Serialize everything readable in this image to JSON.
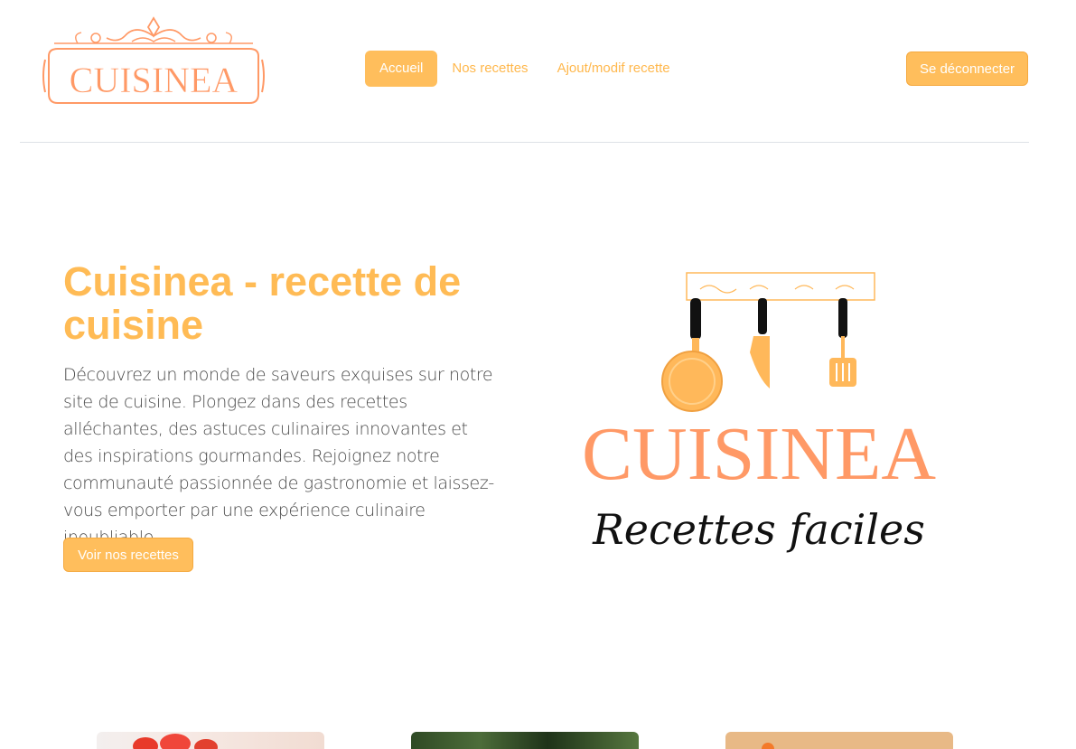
{
  "brand": {
    "logo_text": "CUISINEA",
    "accent_color": "#ffbe5c",
    "logo_color": "#ff9966"
  },
  "nav": {
    "items": [
      {
        "label": "Accueil",
        "active": true
      },
      {
        "label": "Nos recettes",
        "active": false
      },
      {
        "label": "Ajout/modif recette",
        "active": false
      }
    ],
    "logout_label": "Se déconnecter"
  },
  "hero": {
    "title": "Cuisinea - recette de cuisine",
    "text": "Découvrez un monde de saveurs exquises sur notre site de cuisine. Plongez dans des recettes alléchantes, des astuces culinaires innovantes et des inspirations gourmandes. Rejoignez notre communauté passionnée de gastronomie et laissez-vous emporter par une expérience culinaire inoubliable.",
    "button_label": "Voir nos recettes",
    "image": {
      "logo_text": "CUISINEA",
      "tagline": "Recettes faciles"
    }
  },
  "cards": [
    {
      "name": "recipe-card-1"
    },
    {
      "name": "recipe-card-2"
    },
    {
      "name": "recipe-card-3"
    }
  ]
}
